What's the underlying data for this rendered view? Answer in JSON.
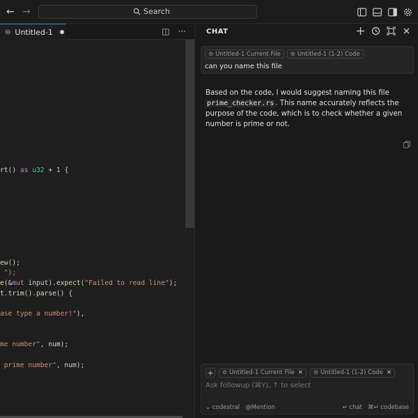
{
  "titlebar": {
    "back_icon": "arrow-left-icon",
    "forward_icon": "arrow-right-icon",
    "search_label": "Search",
    "layout_icons": [
      "sidebar-left-icon",
      "panel-bottom-icon",
      "sidebar-right-icon",
      "settings-gear-icon"
    ]
  },
  "editor": {
    "tab_label": "Untitled-1",
    "code_lines": [
      {
        "row": 12,
        "parts": [
          [
            "rt() ",
            ""
          ],
          [
            "as",
            "kw"
          ],
          [
            " ",
            ""
          ],
          [
            "u32",
            "ty"
          ],
          [
            " + ",
            ""
          ],
          [
            "1",
            "num"
          ],
          [
            " {",
            ""
          ]
        ]
      },
      {
        "row": 21,
        "parts": [
          [
            "ew",
            "fn"
          ],
          [
            "();",
            ""
          ]
        ]
      },
      {
        "row": 22,
        "parts": [
          [
            " \");",
            "str"
          ]
        ]
      },
      {
        "row": 23,
        "parts": [
          [
            "e",
            "fn"
          ],
          [
            "(&",
            ""
          ],
          [
            "mut",
            "kw"
          ],
          [
            " input).",
            ""
          ],
          [
            "expect",
            "fn"
          ],
          [
            "(",
            ""
          ],
          [
            "\"Failed to read line\"",
            "str"
          ],
          [
            ");",
            ""
          ]
        ]
      },
      {
        "row": 24,
        "parts": [
          [
            "t.",
            ""
          ],
          [
            "trim",
            "fn"
          ],
          [
            "().",
            ""
          ],
          [
            "parse",
            "fn"
          ],
          [
            "() {",
            ""
          ]
        ]
      },
      {
        "row": 26,
        "parts": [
          [
            "ase type a number!\"",
            "str"
          ],
          [
            "),",
            ""
          ]
        ]
      },
      {
        "row": 29,
        "parts": [
          [
            "me number\"",
            "str"
          ],
          [
            ", num);",
            ""
          ]
        ]
      },
      {
        "row": 31,
        "parts": [
          [
            " prime number\"",
            "str"
          ],
          [
            ", num);",
            ""
          ]
        ]
      }
    ]
  },
  "chat": {
    "title": "CHAT",
    "header_icons": [
      "plus-icon",
      "history-icon",
      "expand-icon",
      "close-icon"
    ],
    "user_message": {
      "chips": [
        "Untitled-1 Current File",
        "Untitled-1 (1-2) Code"
      ],
      "text": "can you name this file"
    },
    "answer": {
      "before": "Based on the code, I would suggest naming this file",
      "filename": "prime_checker.rs",
      "after": ". This name accurately reflects the purpose of the code, which is to check whether a given number is prime or not."
    },
    "input": {
      "chips": [
        "Untitled-1 Current File",
        "Untitled-1 (1-2) Code"
      ],
      "placeholder": "Ask followup (⌘Y), ↑ to select",
      "model_label": "codestral",
      "mention_label": "Mention",
      "chat_label": "chat",
      "codebase_label": "codebase"
    }
  }
}
